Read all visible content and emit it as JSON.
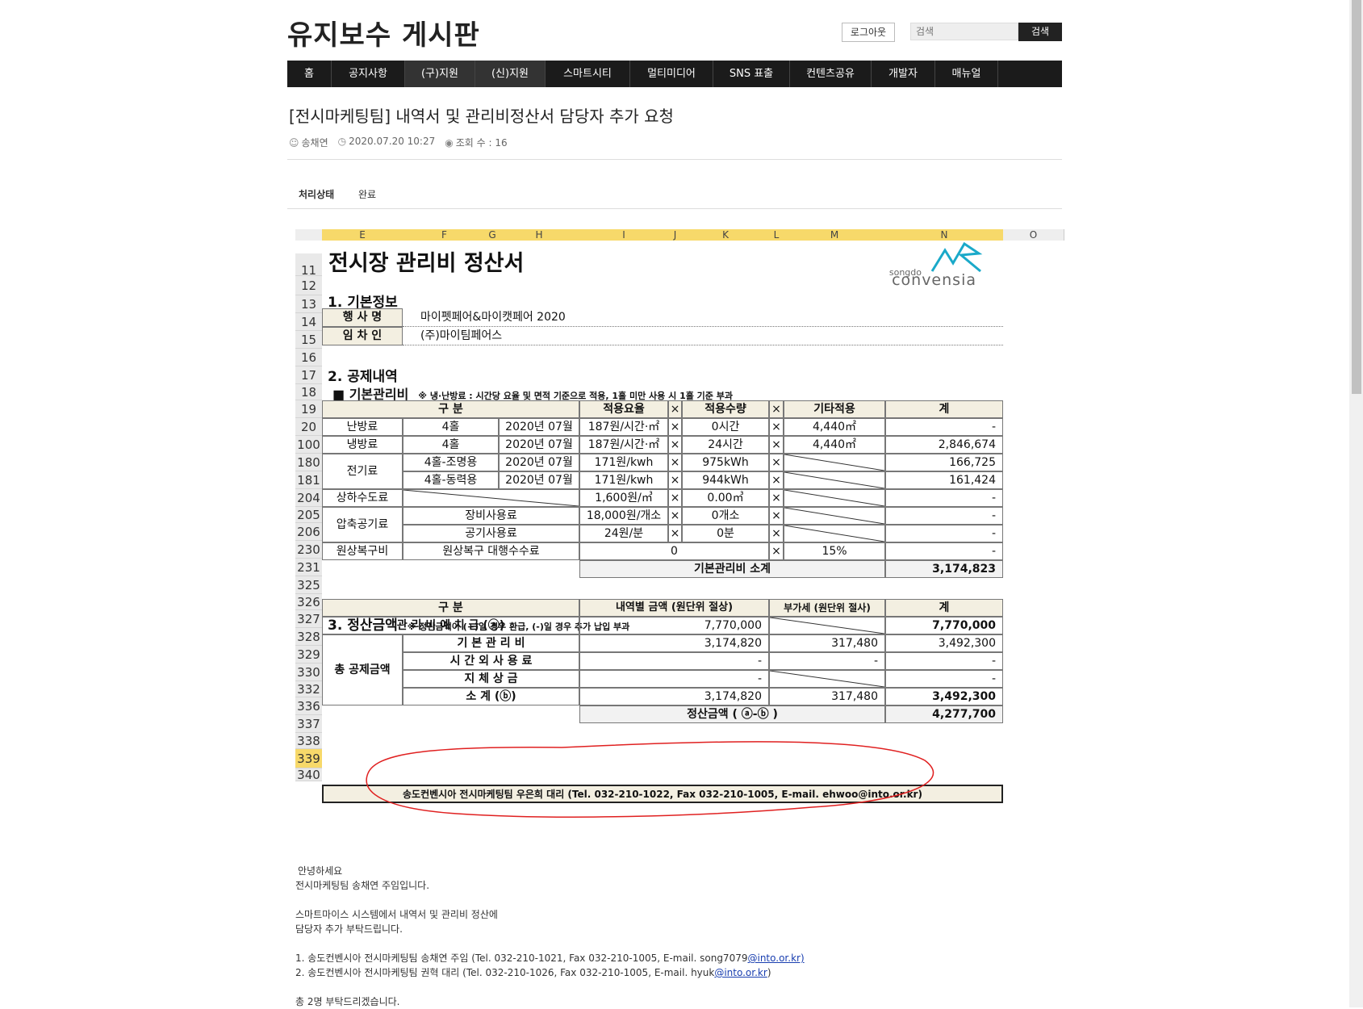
{
  "header": {
    "site_title": "유지보수 게시판",
    "logout_label": "로그아웃",
    "search_placeholder": "검색",
    "search_button": "검색"
  },
  "nav": [
    {
      "label": "홈"
    },
    {
      "label": "공지사항"
    },
    {
      "label": "(구)지원"
    },
    {
      "label": "(신)지원"
    },
    {
      "label": "스마트시티"
    },
    {
      "label": "멀티미디어"
    },
    {
      "label": "SNS 표출"
    },
    {
      "label": "컨텐츠공유"
    },
    {
      "label": "개발자"
    },
    {
      "label": "매뉴얼"
    }
  ],
  "post": {
    "title": "[전시마케팅팀] 내역서 및 관리비정산서 담당자 추가 요청",
    "author": "송채연",
    "date": "2020.07.20 10:27",
    "views": "조회 수 : 16",
    "status_label": "처리상태",
    "status_value": "완료"
  },
  "sheet": {
    "col_headers": [
      "E",
      "F",
      "G",
      "H",
      "I",
      "J",
      "K",
      "L",
      "M",
      "N",
      "O"
    ],
    "title": "전시장 관리비 정산서",
    "logo_top": "songdo",
    "logo_text": "convensia",
    "sec1": "1. 기본정보",
    "event_label": "행 사 명",
    "event_value": "마이펫페어&마이캣페어 2020",
    "renter_label": "임 차 인",
    "renter_value": "(주)마이팀페어스",
    "sec2": "2. 공제내역",
    "basic_mgmt": "■  기본관리비",
    "basic_note": "※ 냉·난방료 : 시간당 요율 및 면적 기준으로 적용, 1홀 미만 사용 시 1홀 기준 부과",
    "th_gubun": "구        분",
    "th_rate": "적용요율",
    "th_qty": "적용수량",
    "th_etc": "기타적용",
    "th_total": "계",
    "x": "×",
    "rows": [
      {
        "a": "난방료",
        "b": "4홀",
        "c": "2020년 07월",
        "rate": "187원/시간·㎡",
        "qty": "0시간",
        "etc": "4,440㎡",
        "total": "-"
      },
      {
        "a": "냉방료",
        "b": "4홀",
        "c": "2020년 07월",
        "rate": "187원/시간·㎡",
        "qty": "24시간",
        "etc": "4,440㎡",
        "total": "2,846,674"
      },
      {
        "a": "전기료",
        "b": "4홀-조명용",
        "c": "2020년 07월",
        "rate": "171원/kwh",
        "qty": "975kWh",
        "etc": "",
        "total": "166,725"
      },
      {
        "a": "",
        "b": "4홀-동력용",
        "c": "2020년 07월",
        "rate": "171원/kwh",
        "qty": "944kWh",
        "etc": "",
        "total": "161,424"
      },
      {
        "a": "상하수도료",
        "b": "",
        "c": "",
        "rate": "1,600원/㎥",
        "qty": "0.00㎥",
        "etc": "",
        "total": "-"
      },
      {
        "a": "압축공기료",
        "b": "장비사용료",
        "c": "",
        "rate": "18,000원/개소",
        "qty": "0개소",
        "etc": "",
        "total": "-"
      },
      {
        "a": "",
        "b": "공기사용료",
        "c": "",
        "rate": "24원/분",
        "qty": "0분",
        "etc": "",
        "total": "-"
      },
      {
        "a": "원상복구비",
        "b": "원상복구 대행수수료",
        "c": "",
        "rate": "0",
        "qty": "",
        "etc": "15%",
        "total": "-"
      }
    ],
    "row_nums": [
      "11",
      "12",
      "13",
      "14",
      "15",
      "16",
      "17",
      "18",
      "19",
      "20",
      "100",
      "180",
      "181",
      "204",
      "205",
      "206",
      "230",
      "231",
      "325",
      "326",
      "327",
      "328",
      "329",
      "330",
      "332",
      "336",
      "337",
      "338",
      "339",
      "340"
    ],
    "subtotal_label": "기본관리비 소계",
    "subtotal_value": "3,174,823",
    "sec3": "3. 정산금액",
    "sec3_note": "※ 정산금액이 (+)일 경우 환급, (-)일 경우 추가 납입 부과",
    "th3_detail": "내역별 금액 (원단위 절상)",
    "th3_vat": "부가세 (원단위 절사)",
    "deposit_label": "관 리 비 예 치 금 (ⓐ)",
    "deposit_amt": "7,770,000",
    "deposit_total": "7,770,000",
    "total_deduct": "총 공제금액",
    "d1_label": "기 본 관 리 비",
    "d1_amt": "3,174,820",
    "d1_vat": "317,480",
    "d1_total": "3,492,300",
    "d2_label": "시 간 외 사 용 료",
    "d2_amt": "-",
    "d2_vat": "-",
    "d2_total": "-",
    "d3_label": "지    체    상    금",
    "d3_amt": "-",
    "d3_total": "-",
    "sub_label": "소        계 (ⓑ)",
    "sub_amt": "3,174,820",
    "sub_vat": "317,480",
    "sub_total": "3,492,300",
    "settle_label": "정산금액 ( ⓐ-ⓑ )",
    "settle_total": "4,277,700",
    "contact": "송도컨벤시아 전시마케팅팀 우은희 대리 (Tel. 032-210-1022, Fax 032-210-1005, E-mail. ehwoo@into.or.kr)"
  },
  "body": {
    "l1": "안녕하세요",
    "l2": "전시마케팅팀 송채연 주임입니다.",
    "l3": "스마트마이스 시스템에서 내역서 및 관리비 정산에",
    "l4": "담당자 추가 부탁드립니다.",
    "l5_pre": "1. 송도컨벤시아 전시마케팅팀 송채연 주임 (Tel. 032-210-1021, Fax 032-210-1005, E-mail. song7079",
    "l5_link": "@into.or.kr)",
    "l6_pre": "2. 송도컨벤시아 전시마케팅팀 권혁 대리 (Tel. 032-210-1026, Fax 032-210-1005, E-mail. hyuk",
    "l6_link": "@into.or.kr",
    "l6_post": ")",
    "l7": "총 2명 부탁드리겠습니다."
  }
}
